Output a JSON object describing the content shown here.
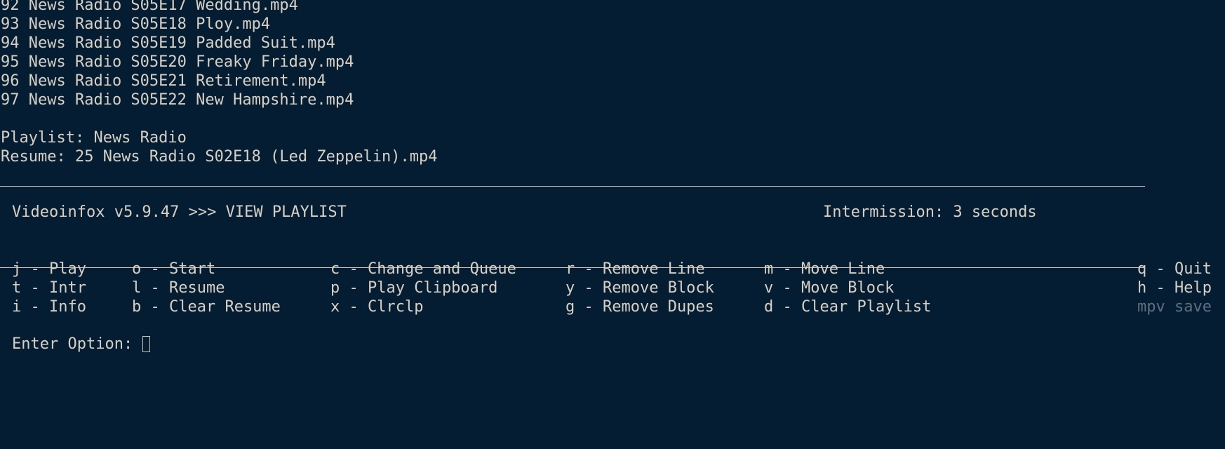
{
  "terminal": {
    "background_color": "#051d33",
    "text_color": "#d6d0c4",
    "dim_color": "#5d6f7d"
  },
  "playlist_lines": [
    "92 News Radio S05E17 Wedding.mp4",
    "93 News Radio S05E18 Ploy.mp4",
    "94 News Radio S05E19 Padded Suit.mp4",
    "95 News Radio S05E20 Freaky Friday.mp4",
    "96 News Radio S05E21 Retirement.mp4",
    "97 News Radio S05E22 New Hampshire.mp4"
  ],
  "meta": {
    "playlist_line": "Playlist: News Radio",
    "resume_line": "Resume: 25 News Radio S02E18 (Led Zeppelin).mp4"
  },
  "status": {
    "left": "Videoinfox v5.9.47 >>> VIEW PLAYLIST",
    "right": "Intermission: 3 seconds"
  },
  "menu": {
    "rows": [
      [
        "j - Play",
        "o - Start",
        "c - Change and Queue",
        "r - Remove Line",
        "m - Move Line",
        "q - Quit"
      ],
      [
        "t - Intr",
        "l - Resume",
        "p - Play Clipboard",
        "y - Remove Block",
        "v - Move Block",
        "h - Help"
      ],
      [
        "i - Info",
        "b - Clear Resume",
        "x - Clrclp",
        "g - Remove Dupes",
        "d - Clear Playlist",
        "mpv save"
      ]
    ]
  },
  "prompt": {
    "label": "Enter Option: ",
    "value": ""
  }
}
